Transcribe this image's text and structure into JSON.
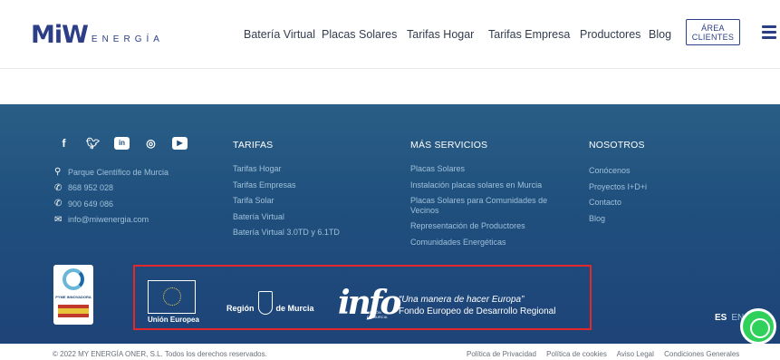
{
  "header": {
    "logo_word": "MiW",
    "logo_sub": "ENERGÍA",
    "nav": [
      "Batería Virtual",
      "Placas Solares",
      "Tarifas Hogar",
      "Tarifas Empresa",
      "Productores",
      "Blog"
    ],
    "area_line1": "ÁREA",
    "area_line2": "CLIENTES"
  },
  "footer": {
    "social_icons": [
      "facebook-icon",
      "twitter-icon",
      "linkedin-icon",
      "instagram-icon",
      "youtube-icon"
    ],
    "contact": [
      {
        "icon": "location-icon",
        "text": "Parque Científico de Murcia"
      },
      {
        "icon": "phone-icon",
        "text": "868 952 028"
      },
      {
        "icon": "phone-icon",
        "text": "900 649 086"
      },
      {
        "icon": "mail-icon",
        "text": "info@miwenergia.com"
      }
    ],
    "columns": [
      {
        "title": "TARIFAS",
        "items": [
          "Tarifas Hogar",
          "Tarifas Empresas",
          "Tarifa Solar",
          "Batería Virtual",
          "Batería Virtual 3.0TD y 6.1TD"
        ]
      },
      {
        "title": "MÁS SERVICIOS",
        "items": [
          "Placas Solares",
          "Instalación placas solares en Murcia",
          "Placas Solares para Comunidades de Vecinos",
          "Representación de Productores",
          "Comunidades Energéticas"
        ]
      },
      {
        "title": "NOSOTROS",
        "items": [
          "Conócenos",
          "Proyectos I+D+i",
          "Contacto",
          "Blog"
        ]
      }
    ],
    "left_logo_text": "PYME INNOVADORA",
    "eu_text": "Unión Europea",
    "region_left": "Región",
    "region_right": "de Murcia",
    "info_logo": "info",
    "info_sub_1": "REGIÓN",
    "info_sub_2": "DE MURCIA",
    "feder_line1": "“Una manera de hacer Europa”",
    "feder_line2": "Fondo Europeo de Desarrollo Regional",
    "lang_es": "ES",
    "lang_en": "EN"
  },
  "bottom": {
    "copyright": "© 2022 MY ENERGÍA ONER, S.L. Todos los derechos reservados.",
    "links": [
      "Política de Privacidad",
      "Política de cookies",
      "Aviso Legal",
      "Condiciones Generales"
    ]
  },
  "colors": {
    "brand_navy": "#2c3f86",
    "brand_cyan": "#2aa8c8",
    "footer_blue": "#1f4f7d",
    "highlight_red": "#e3272b",
    "whatsapp_green": "#2fd15a"
  }
}
